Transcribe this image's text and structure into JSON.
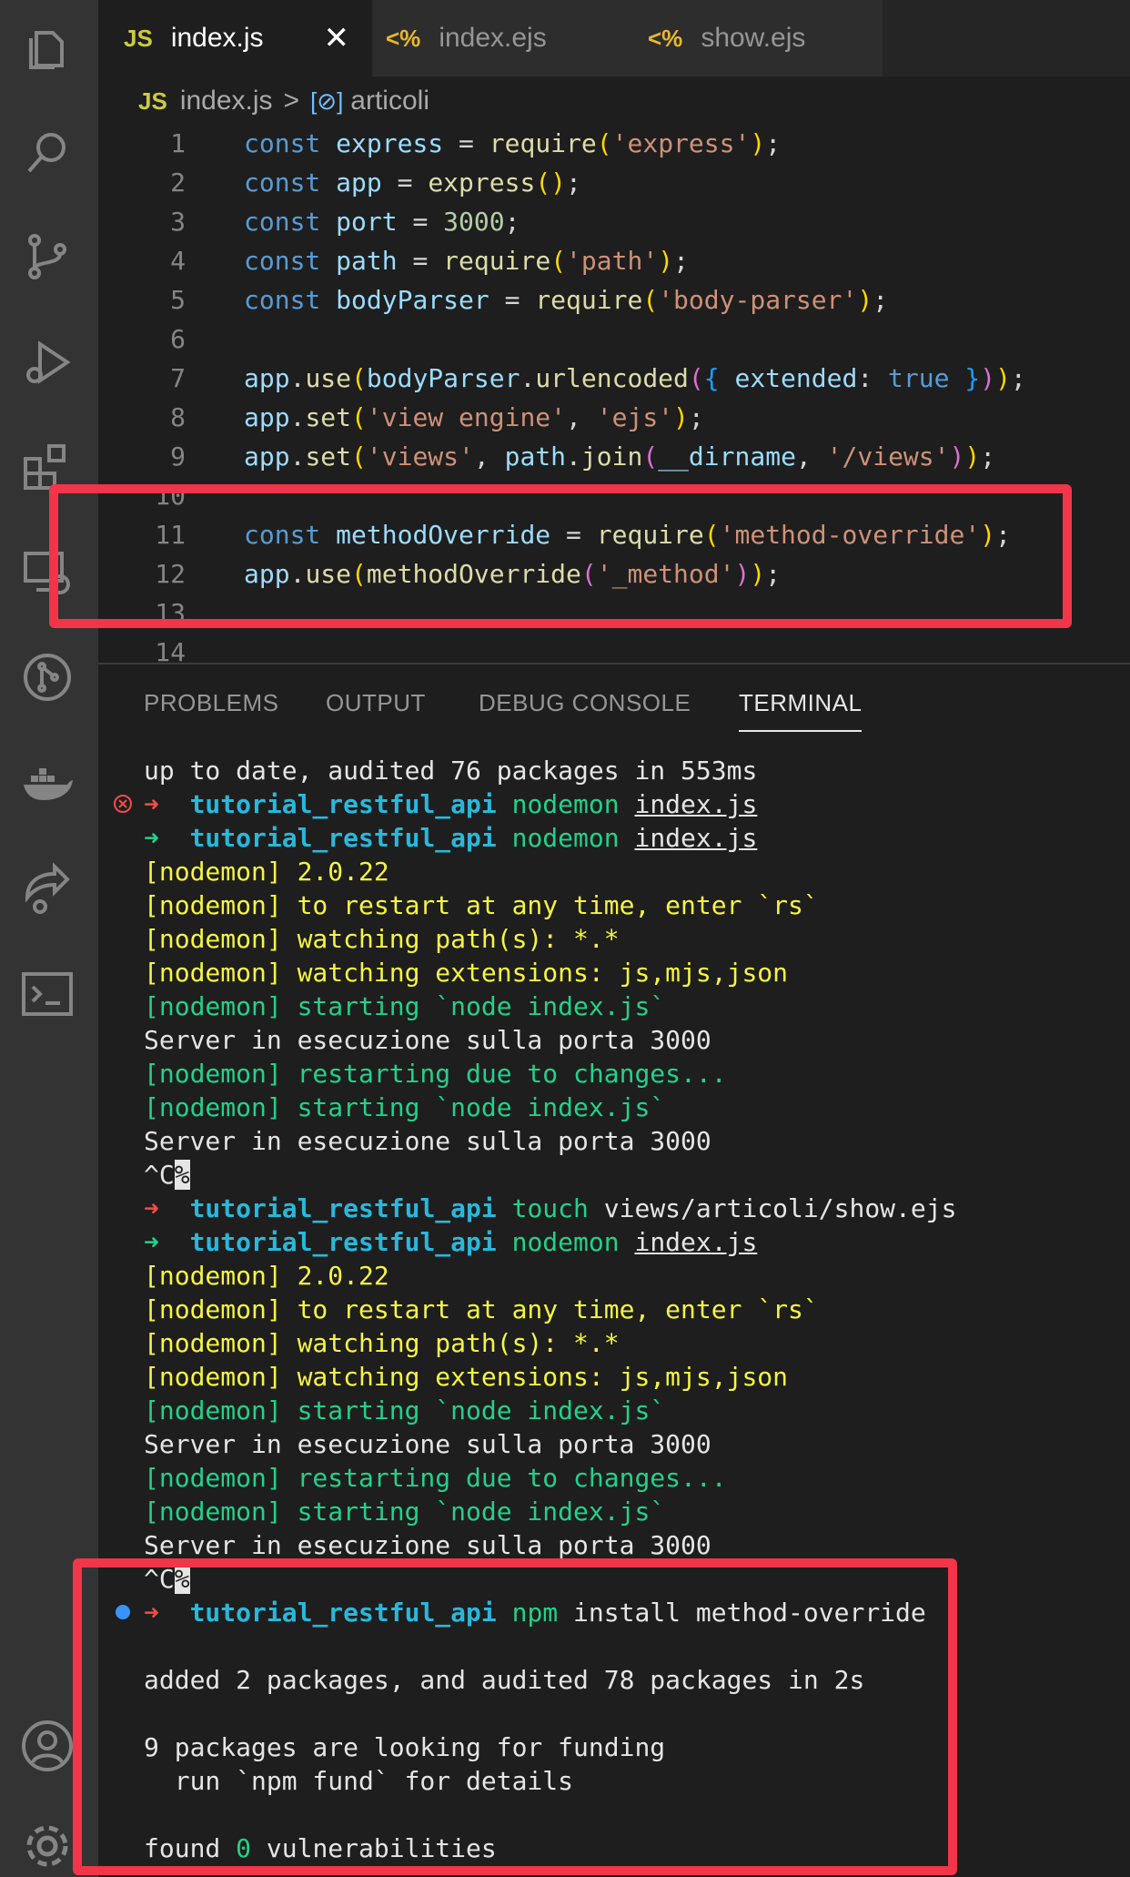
{
  "tabs": [
    {
      "icon": "JS",
      "label": "index.js",
      "active": true
    },
    {
      "icon": "<%",
      "label": "index.ejs",
      "active": false
    },
    {
      "icon": "<%",
      "label": "show.ejs",
      "active": false
    }
  ],
  "tab_close": "✕",
  "breadcrumb": {
    "file_icon": "JS",
    "file": "index.js",
    "separator": ">",
    "symbol_icon": "[⊘]",
    "symbol": "articoli"
  },
  "code": {
    "line_numbers": [
      "1",
      "2",
      "3",
      "4",
      "5",
      "6",
      "7",
      "8",
      "9",
      "10",
      "11",
      "12",
      "13",
      "14"
    ],
    "l1": {
      "kw": "const",
      "v": "express",
      "eq": " = ",
      "fn": "require",
      "p1": "(",
      "s": "'express'",
      "p2": ")",
      "end": ";"
    },
    "l2": {
      "kw": "const",
      "v": "app",
      "eq": " = ",
      "fn": "express",
      "p": "()",
      "end": ";"
    },
    "l3": {
      "kw": "const",
      "v": "port",
      "eq": " = ",
      "n": "3000",
      "end": ";"
    },
    "l4": {
      "kw": "const",
      "v": "path",
      "eq": " = ",
      "fn": "require",
      "p1": "(",
      "s": "'path'",
      "p2": ")",
      "end": ";"
    },
    "l5": {
      "kw": "const",
      "v": "bodyParser",
      "eq": " = ",
      "fn": "require",
      "p1": "(",
      "s": "'body-parser'",
      "p2": ")",
      "end": ";"
    },
    "l7": {
      "o": "app",
      "d1": ".",
      "fn": "use",
      "p1": "(",
      "o2": "bodyParser",
      "d2": ".",
      "fn2": "urlencoded",
      "p2": "(",
      "b1": "{ ",
      "k": "extended",
      "c": ": ",
      "t": "true",
      "b2": " }",
      "p3": ")",
      "p4": ")",
      "end": ";"
    },
    "l8": {
      "o": "app",
      "d": ".",
      "fn": "set",
      "p1": "(",
      "s1": "'view engine'",
      "c": ", ",
      "s2": "'ejs'",
      "p2": ")",
      "end": ";"
    },
    "l9": {
      "o": "app",
      "d": ".",
      "fn": "set",
      "p1": "(",
      "s1": "'views'",
      "c": ", ",
      "o2": "path",
      "d2": ".",
      "fn2": "join",
      "p2": "(",
      "dn": "__dirname",
      "c2": ", ",
      "s2": "'/views'",
      "p3": ")",
      "p4": ")",
      "end": ";"
    },
    "l11": {
      "kw": "const",
      "v": "methodOverride",
      "eq": " = ",
      "fn": "require",
      "p1": "(",
      "s": "'method-override'",
      "p2": ")",
      "end": ";"
    },
    "l12": {
      "o": "app",
      "d": ".",
      "fn": "use",
      "fn2": "methodOverride",
      "p1": "(",
      "p2": "(",
      "s": "'_method'",
      "p3": ")",
      "p4": ")",
      "end": ";"
    }
  },
  "panel_tabs": [
    "PROBLEMS",
    "OUTPUT",
    "DEBUG CONSOLE",
    "TERMINAL"
  ],
  "terminal": {
    "l0": "up to date, audited 76 packages in 553ms",
    "prompt_arrow": "➜",
    "dir": "tutorial_restful_api",
    "nodemon": "nodemon",
    "index": "index.js",
    "ver": "[nodemon] 2.0.22",
    "restart": "[nodemon] to restart at any time, enter `rs`",
    "watch_path": "[nodemon] watching path(s): *.*",
    "watch_ext": "[nodemon] watching extensions: js,mjs,json",
    "starting": "[nodemon] starting `node index.js`",
    "server": "Server in esecuzione sulla porta 3000",
    "restarting": "[nodemon] restarting due to changes...",
    "ctrlc": "^C",
    "pct": "%",
    "touch": "touch",
    "touch_arg": "views/articoli/show.ejs",
    "npm": "npm",
    "npm_args": "install method-override",
    "added": "added 2 packages, and audited 78 packages in 2s",
    "funding": "9 packages are looking for funding",
    "fund": "  run `npm fund` for details",
    "found_a": "found ",
    "found_n": "0",
    "found_b": " vulnerabilities"
  },
  "colors": {
    "highlight": "#f23548",
    "accent_js": "#cbcb41",
    "ejs": "#e8b82b"
  }
}
